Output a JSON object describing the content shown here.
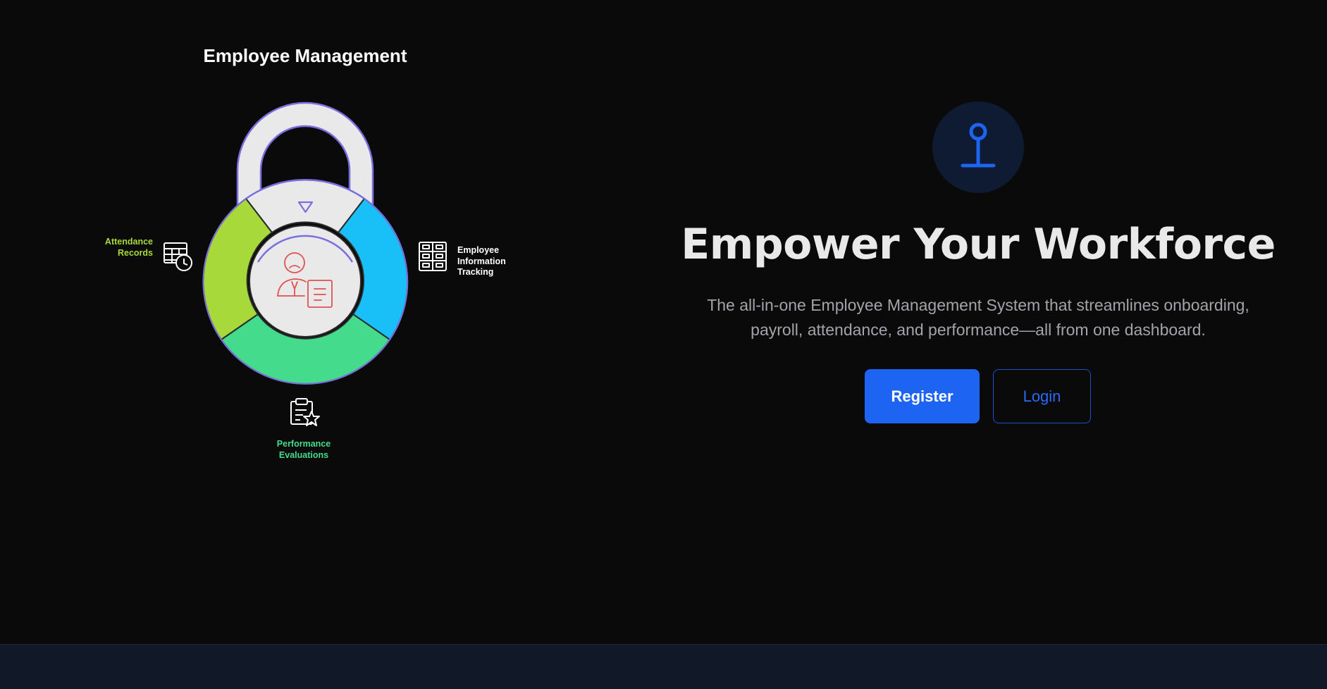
{
  "diagram": {
    "title": "Employee Management",
    "labels": {
      "attendance_line1": "Attendance",
      "attendance_line2": "Records",
      "employee_info_line1": "Employee",
      "employee_info_line2": "Information",
      "employee_info_line3": "Tracking",
      "performance_line1": "Performance",
      "performance_line2": "Evaluations"
    },
    "icons": [
      "calendar-clock-icon",
      "file-cabinet-icon",
      "clipboard-star-icon",
      "employee-document-icon",
      "triangle-down-icon"
    ],
    "colors": {
      "attendance": "#a7d93a",
      "employee_info": "#19c0f7",
      "performance": "#45db8c",
      "lock_body": "#e9e9ea",
      "lock_outline": "#7b6fe0",
      "center_icon": "#e0524f"
    }
  },
  "hero": {
    "badge_icon": "anchor-pin-icon",
    "title": "Empower Your Workforce",
    "subtitle_line1": "The all-in-one Employee Management System that streamlines onboarding,",
    "subtitle_line2": "payroll, attendance, and performance—all from one dashboard.",
    "register_label": "Register",
    "login_label": "Login",
    "accent_color": "#1d64f2"
  }
}
